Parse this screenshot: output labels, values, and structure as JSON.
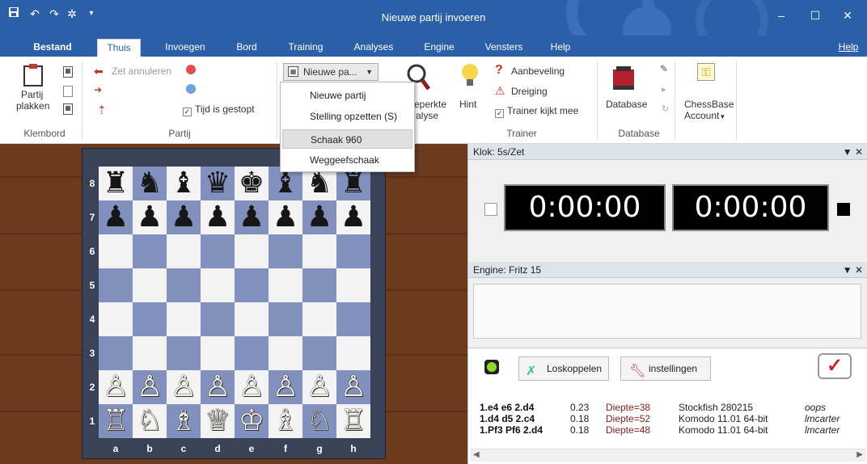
{
  "window": {
    "title": "Nieuwe partij invoeren"
  },
  "quick_access": [
    "save-icon",
    "undo-icon",
    "redo-icon",
    "settings-icon",
    "dropdown-icon"
  ],
  "tabs": [
    {
      "label": "Bestand",
      "active": false,
      "bold": true
    },
    {
      "label": "Thuis",
      "active": true
    },
    {
      "label": "Invoegen"
    },
    {
      "label": "Bord"
    },
    {
      "label": "Training"
    },
    {
      "label": "Analyses"
    },
    {
      "label": "Engine"
    },
    {
      "label": "Vensters"
    },
    {
      "label": "Help"
    }
  ],
  "help_link": "Help",
  "ribbon": {
    "klembord": {
      "paste_label_1": "Partij",
      "paste_label_2": "plakken",
      "group": "Klembord"
    },
    "partij": {
      "undo_move": "Zet annuleren",
      "clock_stopped": "Tijd is gestopt",
      "group": "Partij"
    },
    "new_game_button": "Nieuwe pa...",
    "analysis_partial_1": "eperkte",
    "analysis_partial_2": "alyse",
    "trainer": {
      "hint": "Hint",
      "recommendation": "Aanbeveling",
      "threat": "Dreiging",
      "trainer_watches": "Trainer kijkt mee",
      "group": "Trainer"
    },
    "database": {
      "label": "Database",
      "group": "Database"
    },
    "account": {
      "label_1": "ChessBase",
      "label_2": "Account"
    }
  },
  "dropdown": {
    "items": [
      {
        "label": "Nieuwe partij"
      },
      {
        "label": "Stelling opzetten (S)"
      },
      {
        "label": "Schaak 960",
        "highlighted": true
      },
      {
        "label": "Weggeefschaak"
      }
    ]
  },
  "board": {
    "ranks": [
      "8",
      "7",
      "6",
      "5",
      "4",
      "3",
      "2",
      "1"
    ],
    "files": [
      "a",
      "b",
      "c",
      "d",
      "e",
      "f",
      "g",
      "h"
    ],
    "position": [
      [
        "♜",
        "♞",
        "♝",
        "♛",
        "♚",
        "♝",
        "♞",
        "♜"
      ],
      [
        "♟",
        "♟",
        "♟",
        "♟",
        "♟",
        "♟",
        "♟",
        "♟"
      ],
      [
        "",
        "",
        "",
        "",
        "",
        "",
        "",
        ""
      ],
      [
        "",
        "",
        "",
        "",
        "",
        "",
        "",
        ""
      ],
      [
        "",
        "",
        "",
        "",
        "",
        "",
        "",
        ""
      ],
      [
        "",
        "",
        "",
        "",
        "",
        "",
        "",
        ""
      ],
      [
        "♙",
        "♙",
        "♙",
        "♙",
        "♙",
        "♙",
        "♙",
        "♙"
      ],
      [
        "♖",
        "♘",
        "♗",
        "♕",
        "♔",
        "♗",
        "♘",
        "♖"
      ]
    ],
    "light_color": "#f3f3f3",
    "dark_color": "#8190bd"
  },
  "clock_panel": {
    "title": "Klok: 5s/Zet",
    "white_time": "0:00:00",
    "black_time": "0:00:00"
  },
  "engine_panel": {
    "title": "Engine: Fritz 15"
  },
  "analysis_panel": {
    "disconnect_button": "Loskoppelen",
    "settings_button": "instellingen",
    "rows": [
      {
        "moves": "1.e4 e6 2.d4",
        "eval": "0.23",
        "depth": "Diepte=38",
        "engine": "Stockfish 280215",
        "user": "oops"
      },
      {
        "moves": "1.d4 d5 2.c4",
        "eval": "0.18",
        "depth": "Diepte=52",
        "engine": "Komodo 11.01 64-bit",
        "user": "lmcarter"
      },
      {
        "moves": "1.Pf3 Pf6 2.d4",
        "eval": "0.18",
        "depth": "Diepte=48",
        "engine": "Komodo 11.01 64-bit",
        "user": "lmcarter"
      }
    ]
  }
}
